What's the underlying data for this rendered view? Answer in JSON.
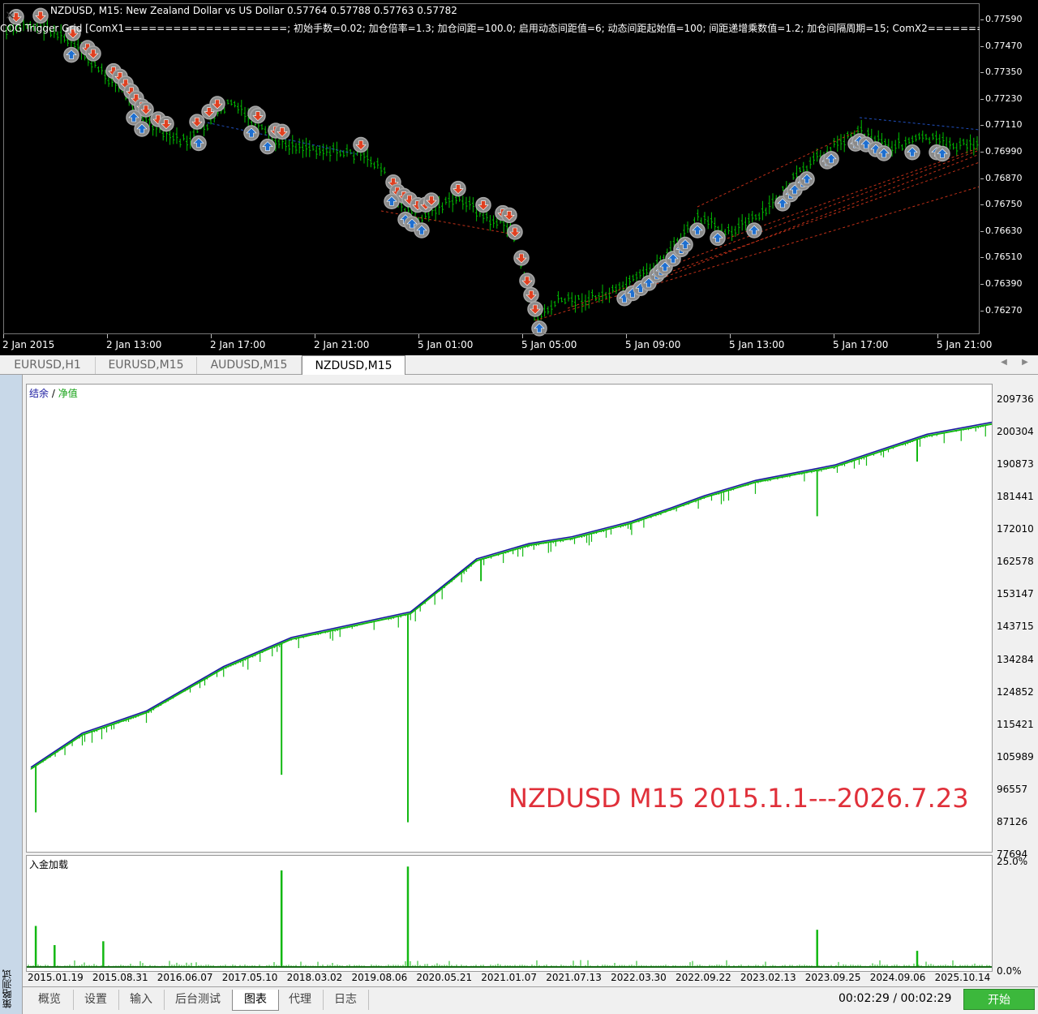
{
  "price_chart": {
    "symbol_header": "NZDUSD, M15:  New Zealand Dollar vs US Dollar  0.57764 0.57788 0.57763 0.57782",
    "indicator_line": "COG Trigger Grid [ComX1====================; 初始手数=0.02; 加仓倍率=1.3; 加仓间距=100.0; 启用动态间距值=6; 动态间距起始值=100; 间距递增乘数值=1.2; 加仓间隔周期=15; ComX2==============",
    "y_labels": [
      "0.77590",
      "0.77470",
      "0.77350",
      "0.77230",
      "0.77110",
      "0.76990",
      "0.76870",
      "0.76750",
      "0.76630",
      "0.76510",
      "0.76390",
      "0.76270"
    ],
    "x_labels": [
      "2 Jan 2015",
      "2 Jan 13:00",
      "2 Jan 17:00",
      "2 Jan 21:00",
      "5 Jan 01:00",
      "5 Jan 05:00",
      "5 Jan 09:00",
      "5 Jan 13:00",
      "5 Jan 17:00",
      "5 Jan 21:00"
    ],
    "colors": {
      "background": "#000000",
      "candle": "#00c000",
      "sell_arrow": "#e04020",
      "buy_arrow": "#1e6fd0",
      "marker_ring": "#a8a8a8"
    }
  },
  "chart_tabs": [
    {
      "label": "EURUSD,H1",
      "active": false
    },
    {
      "label": "EURUSD,M15",
      "active": false
    },
    {
      "label": "AUDUSD,M15",
      "active": false
    },
    {
      "label": "NZDUSD,M15",
      "active": true
    }
  ],
  "tester": {
    "vertical_title": "策略测试",
    "close_glyph": "✕",
    "balance_legend": {
      "balance": "结余",
      "sep": " / ",
      "equity": "净值"
    },
    "load_legend": "入金加载",
    "watermark": "NZDUSD M15 2015.1.1---2026.7.23",
    "balance_y_labels": [
      "209736",
      "200304",
      "190873",
      "181441",
      "172010",
      "162578",
      "153147",
      "143715",
      "134284",
      "124852",
      "115421",
      "105989",
      "96557",
      "87126",
      "77694"
    ],
    "load_y_labels": [
      "25.0%",
      "0.0%"
    ],
    "date_labels": [
      "2015.01.19",
      "2015.08.31",
      "2016.06.07",
      "2017.05.10",
      "2018.03.02",
      "2019.08.06",
      "2020.05.21",
      "2021.01.07",
      "2021.07.13",
      "2022.03.30",
      "2022.09.22",
      "2023.02.13",
      "2023.09.25",
      "2024.09.06",
      "2025.10.14"
    ],
    "colors": {
      "balance": "#1a1aa0",
      "equity": "#12b812",
      "load": "#12b812"
    }
  },
  "bottom_tabs": [
    {
      "label": "概览",
      "active": false
    },
    {
      "label": "设置",
      "active": false
    },
    {
      "label": "输入",
      "active": false
    },
    {
      "label": "后台测试",
      "active": false
    },
    {
      "label": "图表",
      "active": true
    },
    {
      "label": "代理",
      "active": false
    },
    {
      "label": "日志",
      "active": false
    }
  ],
  "timer": "00:02:29 / 00:02:29",
  "start_button": "开始",
  "chart_data": [
    {
      "type": "line",
      "title": "",
      "series": [
        {
          "name": "结余",
          "x": [
            "2015.01.19",
            "2015.08.31",
            "2016.06.07",
            "2017.05.10",
            "2018.03.02",
            "2019.08.06",
            "2020.05.21",
            "2021.01.07",
            "2021.07.13",
            "2022.03.30",
            "2022.09.22",
            "2023.02.13",
            "2023.09.25",
            "2024.09.06",
            "2025.10.14",
            "2026.07.23"
          ],
          "values": [
            101000,
            111000,
            117500,
            130500,
            139000,
            146500,
            162000,
            166500,
            168500,
            173000,
            177000,
            180500,
            185000,
            189500,
            198500,
            202000
          ]
        },
        {
          "name": "净值",
          "x": [
            "2015.01.19",
            "2015.08.31",
            "2016.06.07",
            "2017.05.10",
            "2018.03.02",
            "2019.08.06",
            "2020.05.21",
            "2021.01.07",
            "2021.07.13",
            "2022.03.30",
            "2022.09.22",
            "2023.02.13",
            "2023.09.25",
            "2024.09.06",
            "2025.10.14",
            "2026.07.23"
          ],
          "values": [
            100500,
            110500,
            117000,
            130000,
            138500,
            146000,
            161500,
            166000,
            168000,
            172500,
            176500,
            180000,
            184500,
            189000,
            198000,
            201500
          ]
        }
      ],
      "drawdown_spikes": [
        {
          "x": "2015.02.10",
          "min": 87800
        },
        {
          "x": "2018.01.20",
          "min": 98800
        },
        {
          "x": "2019.07.25",
          "min": 84900
        },
        {
          "x": "2020.06.10",
          "min": 155500
        },
        {
          "x": "2024.06.20",
          "min": 174500
        },
        {
          "x": "2025.09.01",
          "min": 190500
        }
      ],
      "ylim": [
        77694,
        209736
      ]
    },
    {
      "type": "bar",
      "title": "",
      "series": [
        {
          "name": "入金加载",
          "x": [
            "2015.02.10",
            "2015.05.01",
            "2015.12.01",
            "2018.01.20",
            "2019.07.25",
            "2024.06.20",
            "2025.09.01"
          ],
          "values": [
            10.5,
            5.5,
            6.5,
            25.0,
            26.0,
            9.5,
            4.0
          ]
        }
      ],
      "ylim": [
        0,
        25
      ]
    }
  ]
}
